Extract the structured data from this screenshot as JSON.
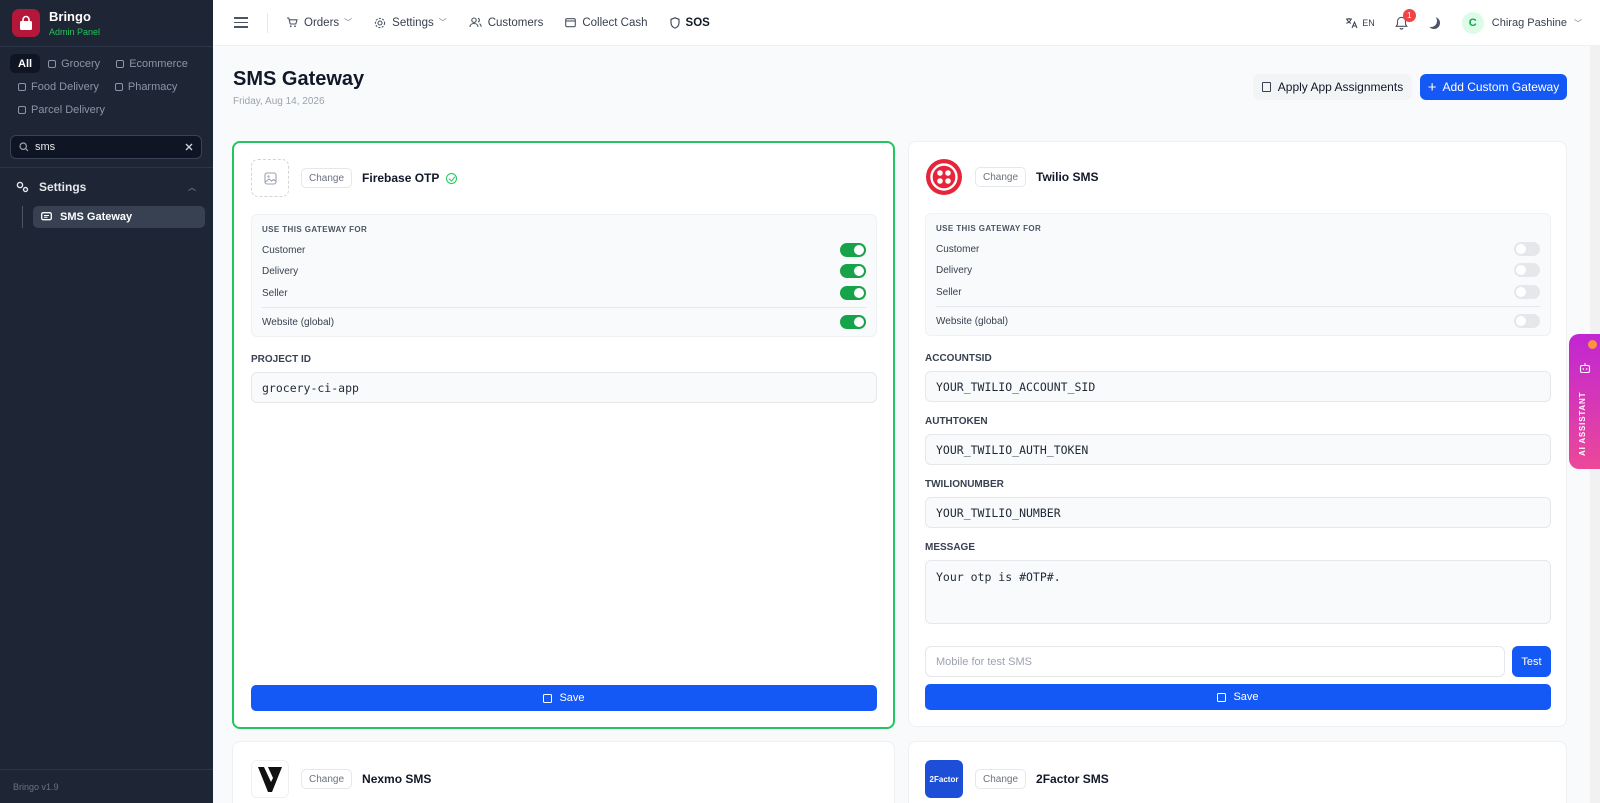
{
  "brand": {
    "name": "Bringo",
    "subtitle": "Admin Panel",
    "version": "Bringo v1.9"
  },
  "filters": [
    "All",
    "Grocery",
    "Ecommerce",
    "Food Delivery",
    "Pharmacy",
    "Parcel Delivery"
  ],
  "sidebar_search": {
    "value": "sms"
  },
  "sidebar_nav": {
    "group": "Settings",
    "item": "SMS Gateway"
  },
  "topnav": {
    "orders": "Orders",
    "settings": "Settings",
    "customers": "Customers",
    "collect_cash": "Collect Cash",
    "sos": "SOS"
  },
  "topright": {
    "lang": "EN",
    "notif_count": "1",
    "user_initial": "C",
    "user_name": "Chirag Pashine"
  },
  "page": {
    "title": "SMS Gateway",
    "date": "Friday, Aug 14, 2026",
    "apply_btn": "Apply App Assignments",
    "add_btn": "Add Custom Gateway"
  },
  "common": {
    "change": "Change",
    "use_for": "USE THIS GATEWAY FOR",
    "customer": "Customer",
    "delivery": "Delivery",
    "seller": "Seller",
    "website": "Website (global)",
    "save": "Save",
    "test": "Test"
  },
  "firebase": {
    "name": "Firebase OTP",
    "toggles": {
      "customer": true,
      "delivery": true,
      "seller": true,
      "website": true
    },
    "project_id_label": "PROJECT ID",
    "project_id": "grocery-ci-app"
  },
  "twilio": {
    "name": "Twilio SMS",
    "toggles": {
      "customer": false,
      "delivery": false,
      "seller": false,
      "website": false
    },
    "accountsid_label": "ACCOUNTSID",
    "accountsid": "YOUR_TWILIO_ACCOUNT_SID",
    "authtoken_label": "AUTHTOKEN",
    "authtoken": "YOUR_TWILIO_AUTH_TOKEN",
    "twilionumber_label": "TWILIONUMBER",
    "twilionumber": "YOUR_TWILIO_NUMBER",
    "message_label": "MESSAGE",
    "message": "Your otp is #OTP#.",
    "test_placeholder": "Mobile for test SMS"
  },
  "nexmo": {
    "name": "Nexmo SMS"
  },
  "twofactor": {
    "name": "2Factor SMS",
    "logo_text": "2Factor"
  },
  "ai_assistant": {
    "label": "AI ASSISTANT"
  },
  "colors": {
    "primary": "#1458f5",
    "success": "#22c55e",
    "sidebar": "#1e2535",
    "brand": "#b4173a",
    "twilio": "#e5263a"
  }
}
